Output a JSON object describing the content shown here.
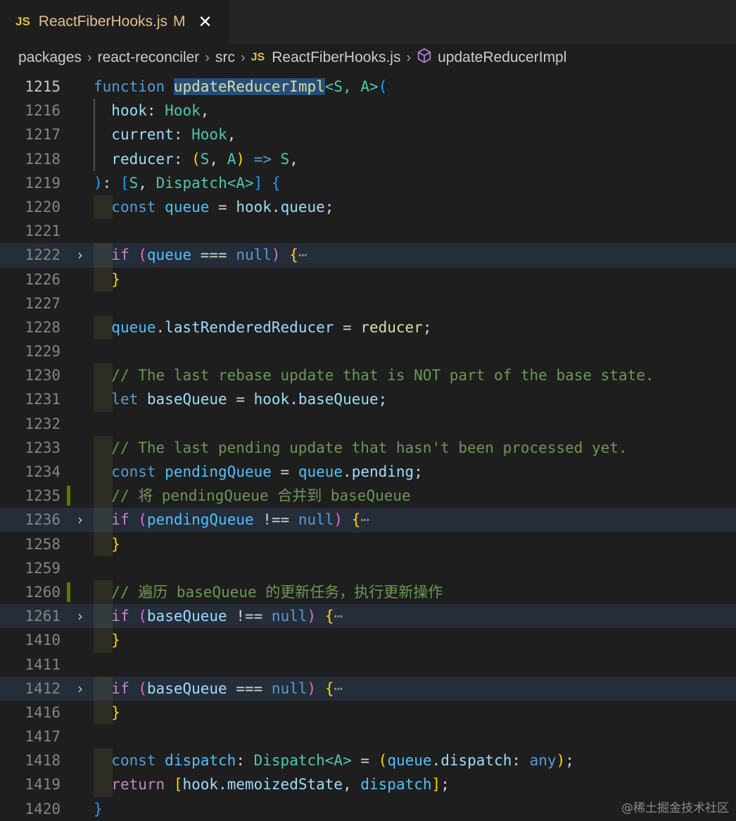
{
  "tab": {
    "language_badge": "JS",
    "title": "ReactFiberHooks.js",
    "status": "M",
    "close": "✕"
  },
  "breadcrumb": {
    "items": [
      "packages",
      "react-reconciler",
      "src",
      "ReactFiberHooks.js",
      "updateReducerImpl"
    ],
    "file_badge": "JS",
    "separator": "›"
  },
  "editor": {
    "current_line": "1215",
    "line_numbers": [
      "1215",
      "1216",
      "1217",
      "1218",
      "1219",
      "1220",
      "1221",
      "1222",
      "1226",
      "1227",
      "1228",
      "1229",
      "1230",
      "1231",
      "1232",
      "1233",
      "1234",
      "1235",
      "1236",
      "1258",
      "1259",
      "1260",
      "1261",
      "1410",
      "1411",
      "1412",
      "1416",
      "1417",
      "1418",
      "1419",
      "1420"
    ],
    "folded_lines": [
      "1222",
      "1236",
      "1261",
      "1412"
    ],
    "modified_lines": [
      "1235",
      "1260"
    ],
    "comments": {
      "c1230": "// The last rebase update that is NOT part of the base state.",
      "c1233": "// The last pending update that hasn't been processed yet.",
      "c1235": "// 将 pendingQueue 合并到 baseQueue",
      "c1260": "// 遍历 baseQueue 的更新任务，执行更新操作"
    },
    "ellipsis": "⋯"
  },
  "watermark": "@稀土掘金技术社区",
  "colors": {
    "background": "#1e1e1e",
    "keyword": "#569cd6",
    "control": "#c586c0",
    "function": "#dcdcaa",
    "variable": "#9cdcfe",
    "type": "#4ec9b0",
    "comment": "#6a9955",
    "selection": "#264f78"
  }
}
